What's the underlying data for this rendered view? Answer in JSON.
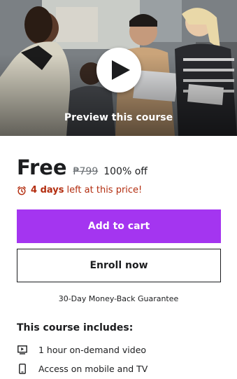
{
  "preview": {
    "label": "Preview this course",
    "icon": "play-icon"
  },
  "pricing": {
    "current": "Free",
    "original": "₱799",
    "discount": "100% off"
  },
  "countdown": {
    "icon": "alarm-clock-icon",
    "emphasis": "4 days",
    "rest": "left at this price!"
  },
  "actions": {
    "add_to_cart": "Add to cart",
    "enroll_now": "Enroll now"
  },
  "guarantee": "30-Day Money-Back Guarantee",
  "includes": {
    "title": "This course includes:",
    "items": [
      {
        "icon": "video-icon",
        "label": "1 hour on-demand video"
      },
      {
        "icon": "mobile-icon",
        "label": "Access on mobile and TV"
      }
    ]
  },
  "colors": {
    "accent": "#a435f0",
    "warning": "#b32d0f",
    "text": "#1c1d1f",
    "muted": "#6a6f73"
  }
}
